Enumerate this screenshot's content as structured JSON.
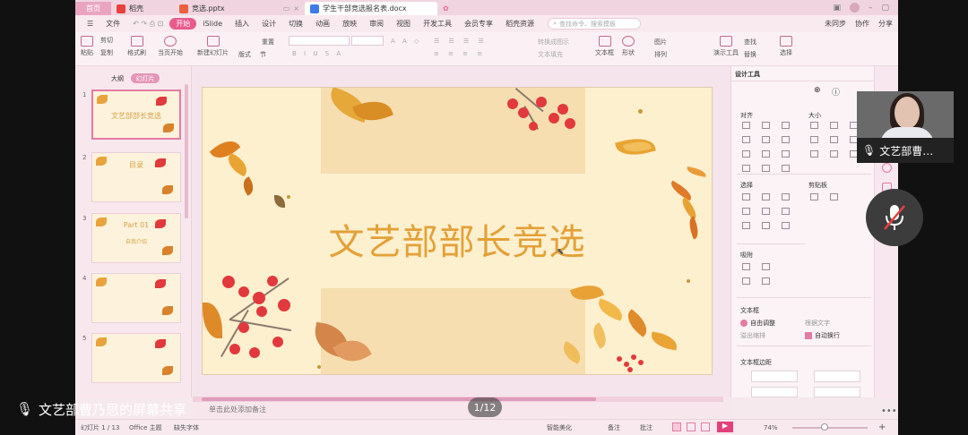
{
  "tabs": {
    "home": "首页",
    "t1": "稻壳",
    "t2": "竞选.pptx",
    "t3": "学生干部竞选报名表.docx"
  },
  "menu": {
    "file": "文件",
    "items": [
      "开始",
      "iSlide",
      "插入",
      "设计",
      "切换",
      "动画",
      "放映",
      "审阅",
      "视图",
      "开发工具",
      "会员专享",
      "稻壳资源"
    ],
    "search_placeholder": "查找命令、搜索模板",
    "right": [
      "未同步",
      "协作",
      "分享"
    ]
  },
  "ribbon": {
    "paste": "粘贴",
    "cut": "剪切",
    "copy": "复制",
    "format_painter": "格式刷",
    "from_current": "当页开始",
    "new_slide": "新建幻灯片",
    "layout": "版式",
    "section": "节",
    "reset": "重置",
    "textbox": "文本框",
    "shape": "形状",
    "picture": "图片",
    "arrange": "排列",
    "find": "查找",
    "replace": "替换",
    "present_tools": "演示工具",
    "select": "选择",
    "convert_smartart": "转换成图示",
    "text_fill": "文本填充"
  },
  "pane": {
    "outline": "大纲",
    "slides": "幻灯片"
  },
  "thumbs": [
    {
      "n": "1",
      "text": "文艺部部长竞选",
      "sub": ""
    },
    {
      "n": "2",
      "text": "目录",
      "sub": ""
    },
    {
      "n": "3",
      "text": "Part 01",
      "sub": "自我介绍"
    },
    {
      "n": "4",
      "text": "",
      "sub": ""
    },
    {
      "n": "5",
      "text": "",
      "sub": ""
    }
  ],
  "slide": {
    "title": "文艺部部长竞选"
  },
  "design_panel": {
    "title": "设计工具",
    "align": "对齐",
    "size": "大小",
    "select": "选择",
    "clipboard": "剪贴板",
    "snap": "吸附",
    "textbox": "文本框",
    "auto_fit": "自由调整",
    "fit_text": "根据文字",
    "overflow": "溢出缩排",
    "auto_wrap": "自动换行",
    "margins": "文本框边距"
  },
  "notes": "单击此处添加备注",
  "status": {
    "slide": "幻灯片 1 / 13",
    "theme": "Office 主题",
    "missing_font": "缺失字体",
    "smart_beautify": "智能美化",
    "notes": "备注",
    "comments": "批注",
    "zoom": "74%"
  },
  "overlay": {
    "page_indicator": "1/12",
    "camera_label": "文艺部曹…",
    "share_label": "文艺部曹乃思的屏幕共享"
  },
  "colors": {
    "accent": "#ea5a8c",
    "title": "#e3a137",
    "berry": "#e2393d"
  }
}
